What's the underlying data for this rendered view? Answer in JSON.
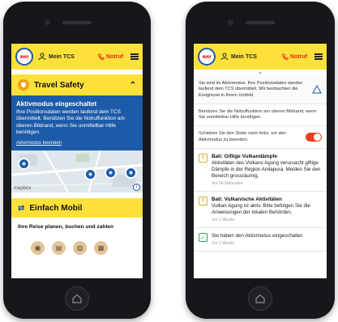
{
  "header": {
    "user_label": "Mein TCS",
    "sos_label": "Notruf"
  },
  "left": {
    "travel_safety_title": "Travel Safety",
    "active_title": "Aktivmodus eingeschaltet",
    "active_text": "Ihre Positionsdaten werden laufend dem TCS übermittelt. Benützen Sie die Notruffunktion am oberen Bildrand, wenn Sie unmittelbar Hilfe benötigen.",
    "active_end": "Aktivmodus beenden",
    "map_credit": "mapbox",
    "mobil_title": "Einfach Mobil",
    "mobil_subtitle": "Ihre Reise planen, buchen und zahlen"
  },
  "right": {
    "info_text": "Sie sind im Aktivmodus. Ihre Positionsdaten werden laufend dem TCS übermittelt. Wir beobachten die Ereignisse in Ihrem Umfeld.",
    "sos_text": "Benützen Sie die Notruffunktion am oberen Bildrand, wenn Sie unmittelbar Hilfe benötigen.",
    "toggle_text": "Schieben Sie den Slider nach links, um den Aktivmodus zu beenden.",
    "notifications": [
      {
        "title": "Bali: Giftige Vulkandämpfe",
        "body": "Aktivitäten des Vulkans Agung verursacht giftige Dämpfe in der Region Amlapura. Meiden Sie den Bereich grossräumig.",
        "time": "Vor 54 Sekunden"
      },
      {
        "title": "Bali: Vulkanische Aktivitäten",
        "body": "Vulkan Agung ist aktiv. Bitte befolgen Sie die Anweisungen der lokalen Behörden.",
        "time": "Vor 1 Minute"
      },
      {
        "title": "",
        "body": "Sie haben den Aktivmodus eingeschaltet.",
        "time": "Vor 1 Minute"
      }
    ]
  },
  "colors": {
    "yellow": "#fde13a",
    "blue": "#1d5ba8",
    "red": "#e2291f",
    "toggle": "#e8401f"
  },
  "icons": [
    "tcs-logo",
    "user-icon",
    "phone-sos-icon",
    "menu-icon",
    "shield-icon",
    "chevron-up-icon",
    "map-poi-icon",
    "info-icon",
    "mobility-icon",
    "transport-icon",
    "hazard-icon",
    "alert-icon",
    "check-icon",
    "home-button-icon"
  ]
}
